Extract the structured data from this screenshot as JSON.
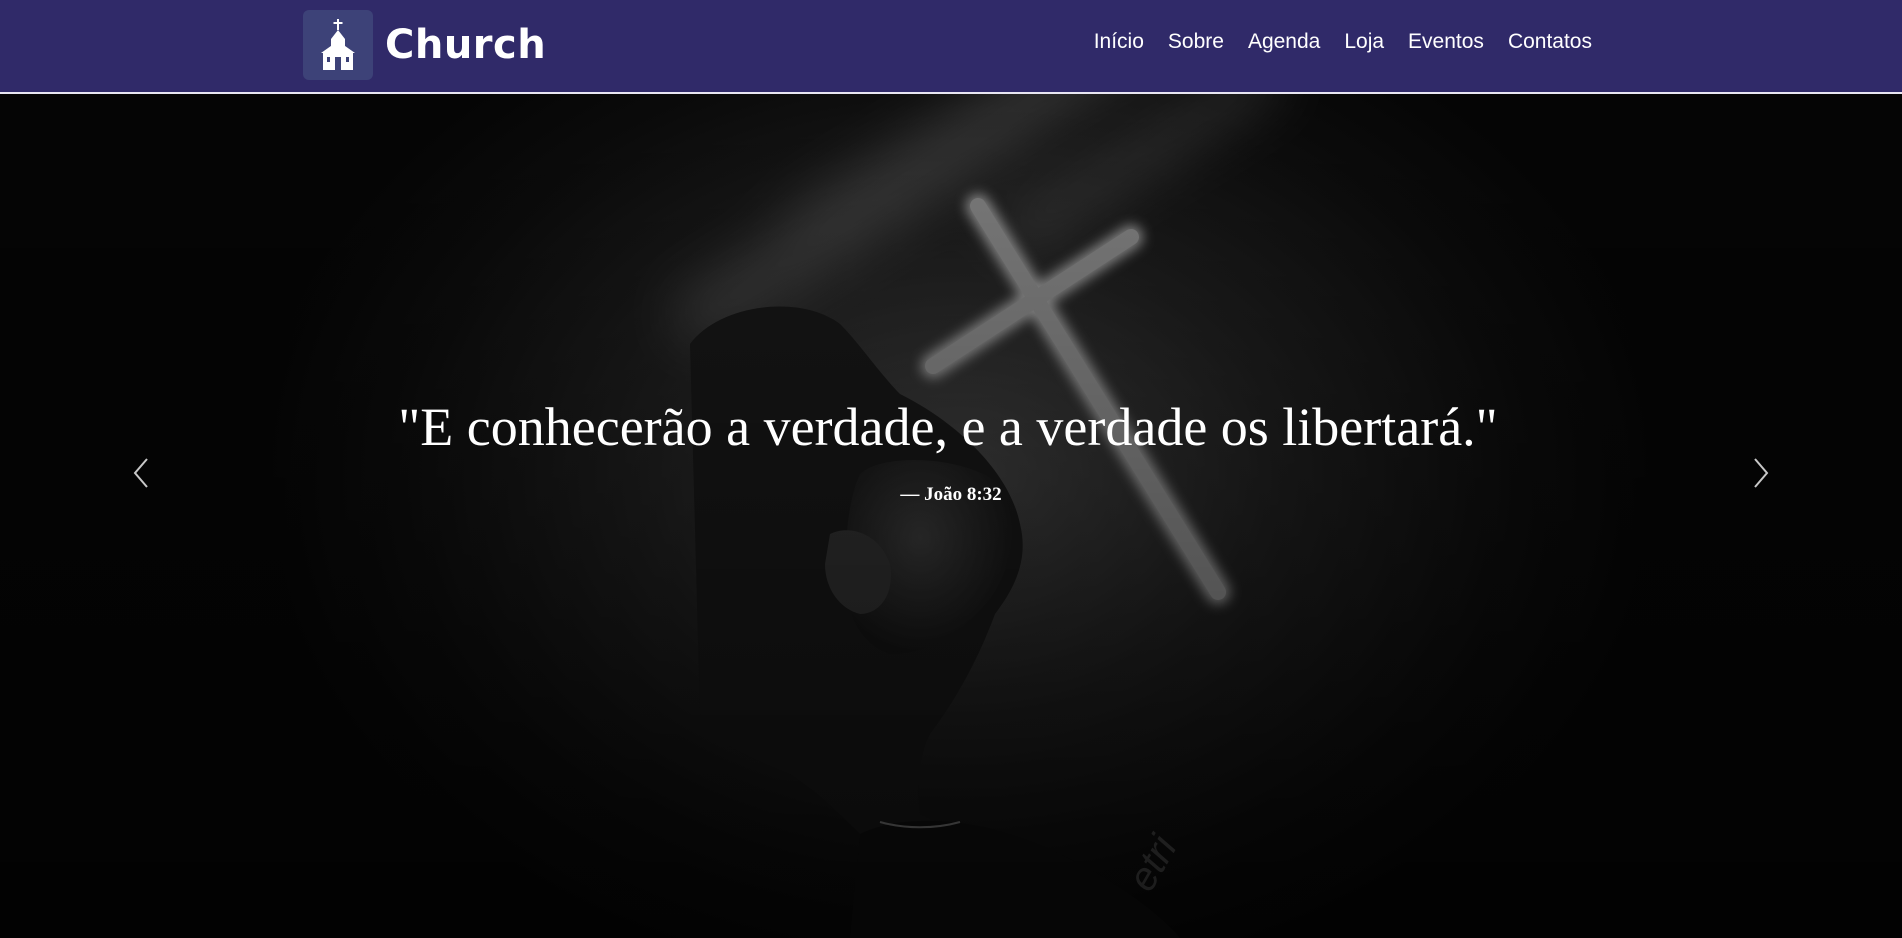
{
  "brand": {
    "name": "Church",
    "logo_icon": "church-icon"
  },
  "nav": {
    "items": [
      {
        "label": "Início"
      },
      {
        "label": "Sobre"
      },
      {
        "label": "Agenda"
      },
      {
        "label": "Loja"
      },
      {
        "label": "Eventos"
      },
      {
        "label": "Contatos"
      }
    ]
  },
  "hero": {
    "quote": "\"E conhecerão a verdade, e a verdade os libertará.\"",
    "reference": "— João 8:32",
    "prev_icon": "chevron-left-icon",
    "next_icon": "chevron-right-icon",
    "background_image": "man-praying-before-glowing-cross-photo"
  },
  "colors": {
    "navbar": "#302a69",
    "logo_tile": "#3d4278",
    "text": "#ffffff"
  }
}
